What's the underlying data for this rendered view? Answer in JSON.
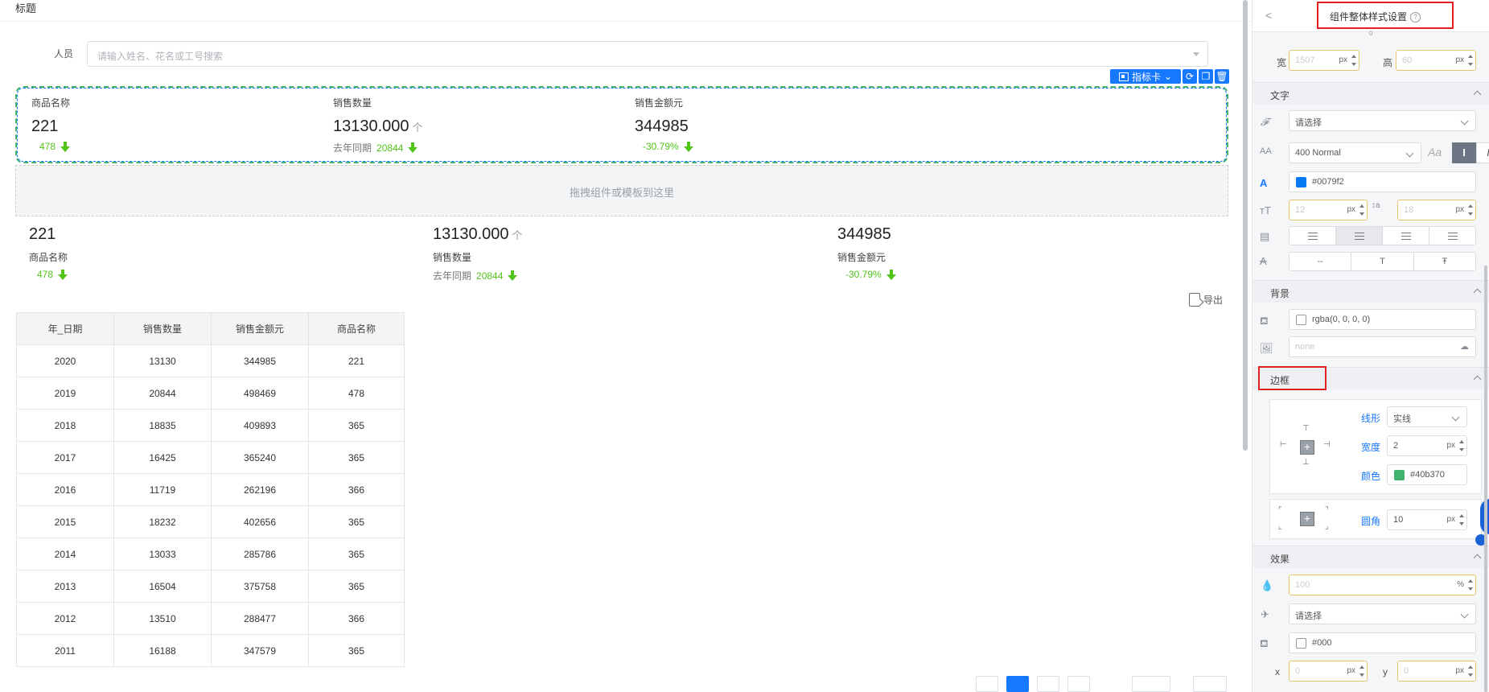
{
  "main": {
    "title": "标题",
    "filter": {
      "label": "人员",
      "placeholder": "请输入姓名、花名或工号搜索"
    },
    "toolbar": {
      "component_type": "指标卡"
    },
    "cards": [
      {
        "label": "商品名称",
        "value": "221",
        "compare_label": "",
        "compare_value": "478"
      },
      {
        "label": "销售数量",
        "value": "13130.000",
        "trend": "个",
        "compare_label": "去年同期",
        "compare_value": "20844"
      },
      {
        "label": "销售金额元",
        "value": "344985",
        "compare_label": "",
        "compare_value": "-30.79%"
      }
    ],
    "drop_zone_text": "拖拽组件或模板到这里",
    "cards2": [
      {
        "label": "商品名称",
        "value": "221",
        "compare_label": "",
        "compare_value": "478"
      },
      {
        "label": "销售数量",
        "value": "13130.000",
        "trend": "个",
        "compare_label": "去年同期",
        "compare_value": "20844"
      },
      {
        "label": "销售金额元",
        "value": "344985",
        "compare_label": "",
        "compare_value": "-30.79%"
      }
    ],
    "export_label": "导出",
    "table": {
      "headers": [
        "年_日期",
        "销售数量",
        "销售金额元",
        "商品名称"
      ],
      "rows": [
        [
          "2020",
          "13130",
          "344985",
          "221"
        ],
        [
          "2019",
          "20844",
          "498469",
          "478"
        ],
        [
          "2018",
          "18835",
          "409893",
          "365"
        ],
        [
          "2017",
          "16425",
          "365240",
          "365"
        ],
        [
          "2016",
          "11719",
          "262196",
          "366"
        ],
        [
          "2015",
          "18232",
          "402656",
          "365"
        ],
        [
          "2014",
          "13033",
          "285786",
          "365"
        ],
        [
          "2013",
          "16504",
          "375758",
          "365"
        ],
        [
          "2012",
          "13510",
          "288477",
          "366"
        ],
        [
          "2011",
          "16188",
          "347579",
          "365"
        ]
      ]
    }
  },
  "panel": {
    "title": "组件整体样式设置",
    "zero_mark": "0",
    "size": {
      "width_label": "宽",
      "width_value": "1507",
      "height_label": "高",
      "height_value": "60",
      "unit": "px"
    },
    "text_section": {
      "title": "文字",
      "font_placeholder": "请选择",
      "weight": "400 Normal",
      "color": "#0079f2",
      "font_size": "12",
      "line_height": "18",
      "unit": "px",
      "decoration": [
        "--",
        "T",
        "Ŧ"
      ]
    },
    "background_section": {
      "title": "背景",
      "color": "rgba(0, 0, 0, 0)",
      "image_placeholder": "none"
    },
    "border_section": {
      "title": "边框",
      "style_label": "线形",
      "style_value": "实线",
      "width_label": "宽度",
      "width_value": "2",
      "unit": "px",
      "color_label": "颜色",
      "color_value": "#40b370",
      "radius_label": "圆角",
      "radius_value": "10"
    },
    "effect_section": {
      "title": "效果",
      "opacity": "100",
      "opacity_unit": "%",
      "animation_placeholder": "请选择",
      "shadow_color": "#000",
      "x_label": "x",
      "x_value": "0",
      "y_label": "y",
      "y_value": "0",
      "unit": "px"
    }
  },
  "colors": {
    "accent": "#1677ff",
    "up_green": "#52c41a",
    "border_green": "#40b370",
    "highlight_red": "#e02020"
  }
}
